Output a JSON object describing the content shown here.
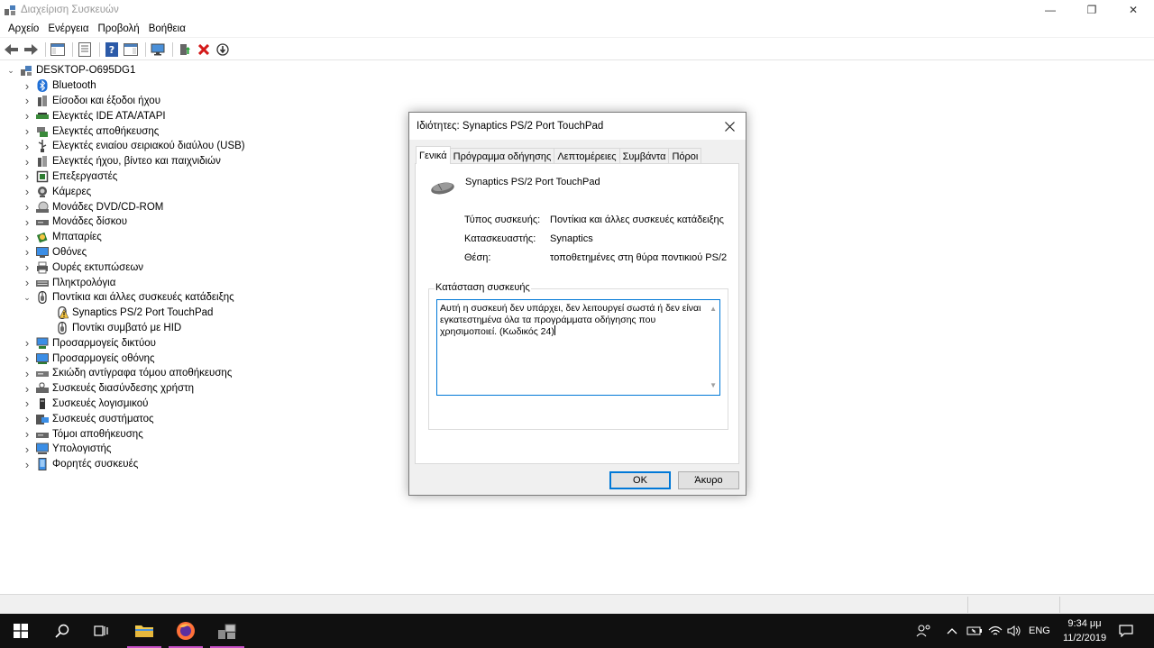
{
  "window": {
    "title": "Διαχείριση Συσκευών",
    "minimize": "—",
    "restore": "❐",
    "close": "✕"
  },
  "menu": [
    "Αρχείο",
    "Ενέργεια",
    "Προβολή",
    "Βοήθεια"
  ],
  "tree": {
    "root": "DESKTOP-O695DG1",
    "items": [
      {
        "label": "Bluetooth",
        "icon": "bluetooth-icon"
      },
      {
        "label": "Είσοδοι και έξοδοι ήχου",
        "icon": "speaker-icon"
      },
      {
        "label": "Ελεγκτές IDE ATA/ATAPI",
        "icon": "ide-controller-icon"
      },
      {
        "label": "Ελεγκτές αποθήκευσης",
        "icon": "storage-controller-icon"
      },
      {
        "label": "Ελεγκτές ενιαίου σειριακού διαύλου (USB)",
        "icon": "usb-icon"
      },
      {
        "label": "Ελεγκτές ήχου, βίντεο και παιχνιδιών",
        "icon": "sound-video-icon"
      },
      {
        "label": "Επεξεργαστές",
        "icon": "processor-icon"
      },
      {
        "label": "Κάμερες",
        "icon": "camera-icon"
      },
      {
        "label": "Μονάδες DVD/CD-ROM",
        "icon": "dvd-drive-icon"
      },
      {
        "label": "Μονάδες δίσκου",
        "icon": "disk-drive-icon"
      },
      {
        "label": "Μπαταρίες",
        "icon": "battery-icon"
      },
      {
        "label": "Οθόνες",
        "icon": "monitor-icon"
      },
      {
        "label": "Ουρές εκτυπώσεων",
        "icon": "printer-icon"
      },
      {
        "label": "Πληκτρολόγια",
        "icon": "keyboard-icon"
      },
      {
        "label": "Ποντίκια και άλλες συσκευές κατάδειξης",
        "icon": "mouse-icon",
        "expanded": true,
        "children": [
          {
            "label": "Synaptics PS/2 Port TouchPad",
            "icon": "warning-mouse-icon"
          },
          {
            "label": "Ποντίκι συμβατό με HID",
            "icon": "mouse-icon"
          }
        ]
      },
      {
        "label": "Προσαρμογείς δικτύου",
        "icon": "network-adapter-icon"
      },
      {
        "label": "Προσαρμογείς οθόνης",
        "icon": "display-adapter-icon"
      },
      {
        "label": "Σκιώδη αντίγραφα τόμου αποθήκευσης",
        "icon": "volume-shadow-icon"
      },
      {
        "label": "Συσκευές διασύνδεσης χρήστη",
        "icon": "hid-icon"
      },
      {
        "label": "Συσκευές λογισμικού",
        "icon": "software-device-icon"
      },
      {
        "label": "Συσκευές συστήματος",
        "icon": "system-device-icon"
      },
      {
        "label": "Τόμοι αποθήκευσης",
        "icon": "storage-volume-icon"
      },
      {
        "label": "Υπολογιστής",
        "icon": "computer-icon"
      },
      {
        "label": "Φορητές συσκευές",
        "icon": "portable-device-icon"
      }
    ]
  },
  "dialog": {
    "title": "Ιδιότητες: Synaptics PS/2 Port TouchPad",
    "tabs": [
      "Γενικά",
      "Πρόγραμμα οδήγησης",
      "Λεπτομέρειες",
      "Συμβάντα",
      "Πόροι"
    ],
    "device_name": "Synaptics PS/2 Port TouchPad",
    "props": {
      "type_label": "Τύπος συσκευής:",
      "type_value": "Ποντίκια και άλλες συσκευές κατάδειξης",
      "manufacturer_label": "Κατασκευαστής:",
      "manufacturer_value": "Synaptics",
      "location_label": "Θέση:",
      "location_value": "τοποθετημένες στη θύρα ποντικιού PS/2"
    },
    "status_legend": "Κατάσταση συσκευής",
    "status_text": "Αυτή η συσκευή δεν υπάρχει, δεν λειτουργεί σωστά ή δεν είναι εγκατεστημένα όλα τα προγράμματα οδήγησης που χρησιμοποιεί. (Κωδικός 24)",
    "ok": "OK",
    "cancel": "Άκυρο"
  },
  "taskbar": {
    "lang": "ENG",
    "time": "9:34 μμ",
    "date": "11/2/2019"
  }
}
